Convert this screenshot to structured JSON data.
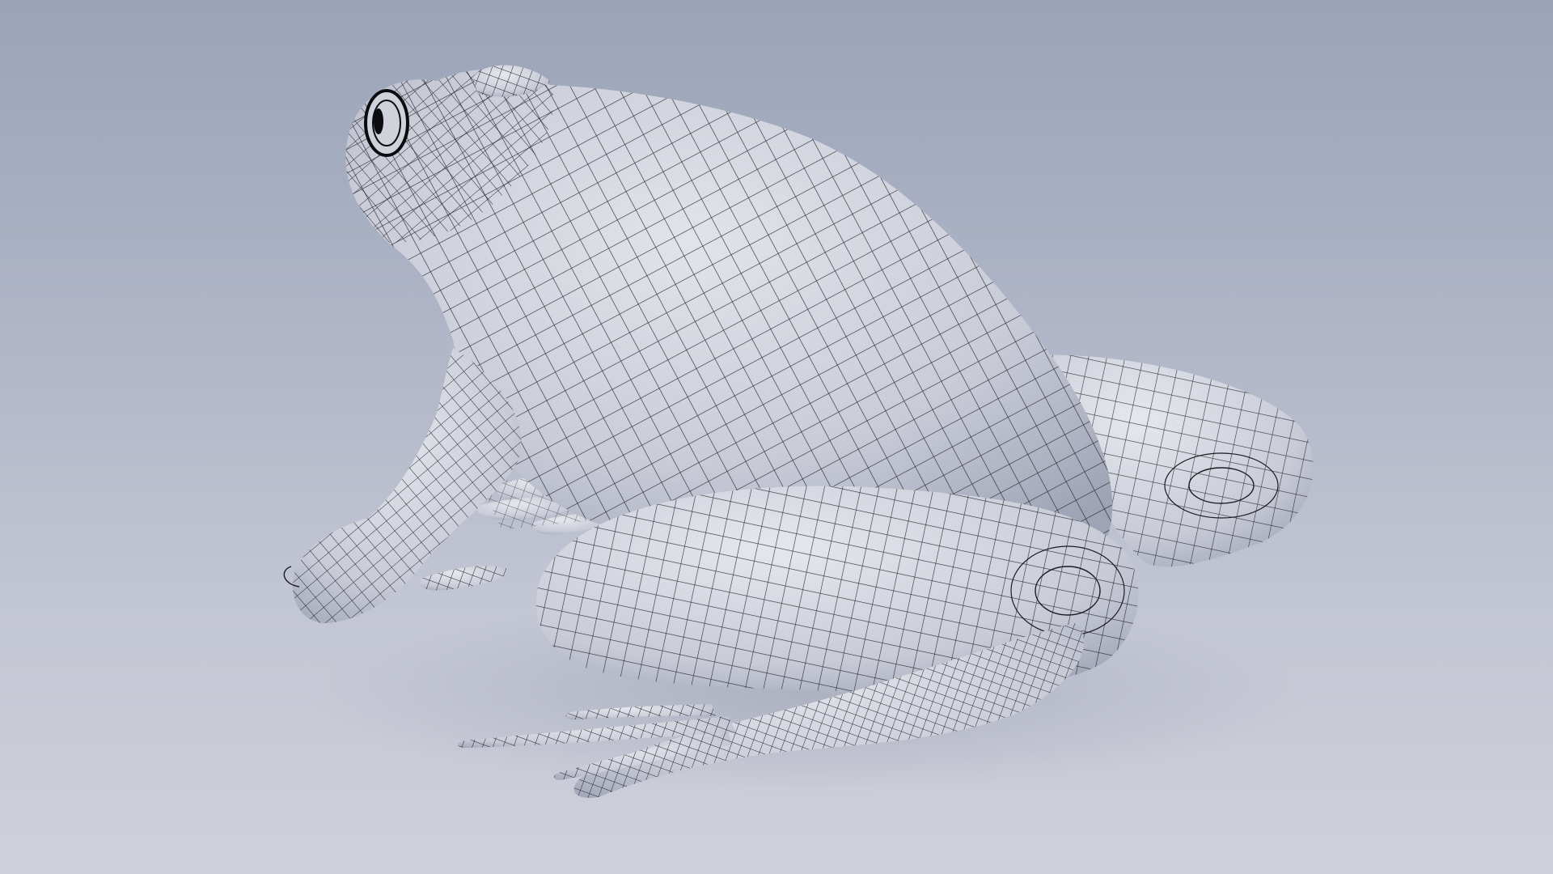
{
  "scene": {
    "subject": "frog-wireframe-model",
    "colors": {
      "background_top": "#9aa3b8",
      "background_bottom": "#cfd0da",
      "surface": "#d6d8e0",
      "surface_shade": "#a9adbd",
      "wire": "#1a1c22",
      "eye": "#0c0c10"
    }
  }
}
